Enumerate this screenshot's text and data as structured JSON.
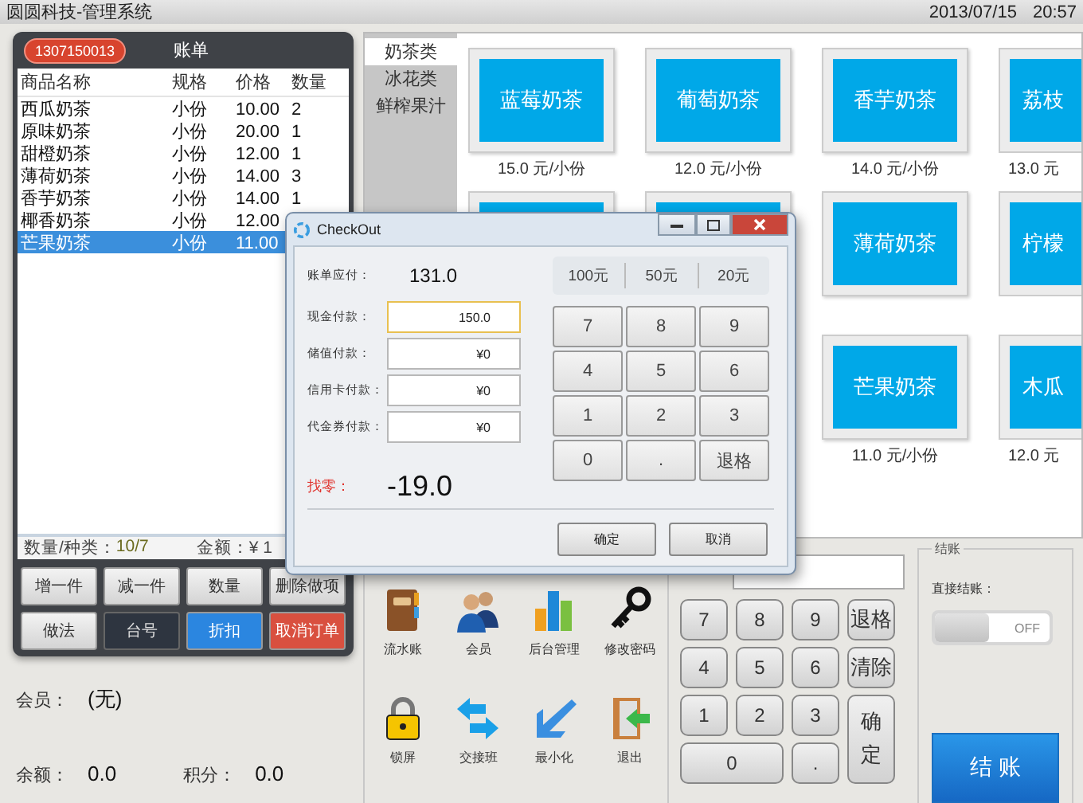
{
  "window": {
    "title": "圆圆科技-管理系统",
    "date": "2013/07/15",
    "time": "20:57"
  },
  "bill": {
    "order_no": "1307150013",
    "title": "账单",
    "columns": [
      "商品名称",
      "规格",
      "价格",
      "数量"
    ],
    "rows": [
      {
        "cells": [
          "西瓜奶茶",
          "小份",
          "10.00",
          "2"
        ],
        "selected": false
      },
      {
        "cells": [
          "原味奶茶",
          "小份",
          "20.00",
          "1"
        ],
        "selected": false
      },
      {
        "cells": [
          "甜橙奶茶",
          "小份",
          "12.00",
          "1"
        ],
        "selected": false
      },
      {
        "cells": [
          "薄荷奶茶",
          "小份",
          "14.00",
          "3"
        ],
        "selected": false
      },
      {
        "cells": [
          "香芋奶茶",
          "小份",
          "14.00",
          "1"
        ],
        "selected": false
      },
      {
        "cells": [
          "椰香奶茶",
          "小份",
          "12.00"
        ],
        "selected": false
      },
      {
        "cells": [
          "芒果奶茶",
          "小份",
          "11.00"
        ],
        "selected": true
      }
    ],
    "count_label": "数量/种类：",
    "count": "10/7",
    "amount": "金额：¥ 1"
  },
  "actions": [
    {
      "label": "增一件",
      "kind": "plain"
    },
    {
      "label": "减一件",
      "kind": "plain"
    },
    {
      "label": "数量",
      "kind": "plain"
    },
    {
      "label": "删除做项",
      "kind": "plain"
    },
    {
      "label": "做法",
      "kind": "plain"
    },
    {
      "label": "台号",
      "kind": "dark"
    },
    {
      "label": "折扣",
      "kind": "primary"
    },
    {
      "label": "取消订单",
      "kind": "danger"
    }
  ],
  "member": {
    "label": "会员：",
    "value": "(无)",
    "balance_label": "余额：",
    "balance": "0.0",
    "points_label": "积分：",
    "points": "0.0"
  },
  "categories": [
    {
      "label": "奶茶类",
      "selected": true
    },
    {
      "label": "冰花类",
      "selected": false
    },
    {
      "label": "鲜榨果汁",
      "selected": false
    }
  ],
  "products": [
    {
      "kind": "full",
      "name": "蓝莓奶茶",
      "price": "15.0 元/小份"
    },
    {
      "kind": "full",
      "name": "葡萄奶茶",
      "price": "12.0 元/小份"
    },
    {
      "kind": "full",
      "name": "香芋奶茶",
      "price": "14.0 元/小份"
    },
    {
      "kind": "cut",
      "name": "荔枝",
      "price": "13.0 元"
    },
    {
      "kind": "covered"
    },
    {
      "kind": "covered"
    },
    {
      "kind": "full",
      "name": "薄荷奶茶"
    },
    {
      "kind": "cut",
      "name": "柠檬"
    },
    {
      "kind": "spacer"
    },
    {
      "kind": "spacer"
    },
    {
      "kind": "full",
      "name": "芒果奶茶",
      "price": "11.0 元/小份"
    },
    {
      "kind": "cut",
      "name": "木瓜",
      "price": "12.0 元"
    }
  ],
  "tools": [
    {
      "label": "流水账",
      "kind": "ledger"
    },
    {
      "label": "会员",
      "kind": "members"
    },
    {
      "label": "后台管理",
      "kind": "chart"
    },
    {
      "label": "修改密码",
      "kind": "key"
    },
    {
      "label": "锁屏",
      "kind": "lock"
    },
    {
      "label": "交接班",
      "kind": "swap"
    },
    {
      "label": "最小化",
      "kind": "minimize"
    },
    {
      "label": "退出",
      "kind": "exit"
    }
  ],
  "keypad": [
    {
      "label": "7",
      "kind": "digit"
    },
    {
      "label": "8",
      "kind": "digit"
    },
    {
      "label": "9",
      "kind": "digit"
    },
    {
      "label": "退格",
      "kind": "digit"
    },
    {
      "label": "4",
      "kind": "digit"
    },
    {
      "label": "5",
      "kind": "digit"
    },
    {
      "label": "6",
      "kind": "digit"
    },
    {
      "label": "清除",
      "kind": "digit"
    },
    {
      "label": "1",
      "kind": "digit"
    },
    {
      "label": "2",
      "kind": "digit"
    },
    {
      "label": "3",
      "kind": "digit"
    },
    {
      "label": "0",
      "kind": "wide"
    },
    {
      "label": ".",
      "kind": "digit"
    },
    {
      "label": "确定",
      "kind": "tall"
    }
  ],
  "checkout": {
    "title": "结账",
    "direct_label": "直接结账：",
    "direct_on": false,
    "off_text": "OFF",
    "button": "结 账"
  },
  "dialog": {
    "title": "CheckOut",
    "due_label": "账单应付：",
    "due": "131.0",
    "payments": [
      {
        "label": "现金付款：",
        "value": "150.0",
        "focused": true
      },
      {
        "label": "储值付款：",
        "value": "¥0",
        "focused": false
      },
      {
        "label": "信用卡付款：",
        "value": "¥0",
        "focused": false
      },
      {
        "label": "代金券付款：",
        "value": "¥0",
        "focused": false
      }
    ],
    "change_label": "找零：",
    "change": "-19.0",
    "quick": [
      "100元",
      "50元",
      "20元"
    ],
    "keys": [
      "7",
      "8",
      "9",
      "4",
      "5",
      "6",
      "1",
      "2",
      "3",
      "0",
      ".",
      "退格"
    ],
    "buttons": [
      "确定",
      "取消"
    ]
  }
}
